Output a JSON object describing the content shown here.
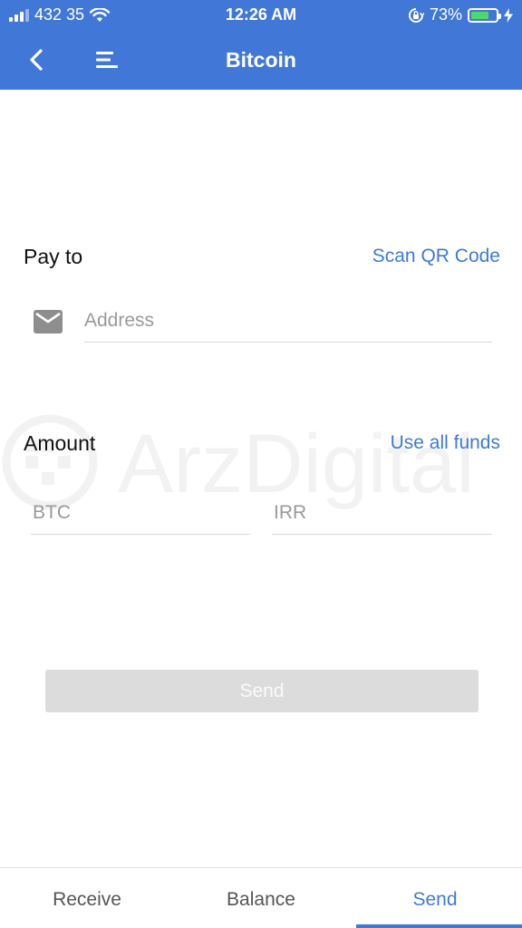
{
  "status_bar": {
    "carrier": "432 35",
    "time": "12:26 AM",
    "battery_percent": "73%",
    "battery_level": 0.73
  },
  "nav": {
    "title": "Bitcoin",
    "back_icon": "chevron-left-icon",
    "menu_icon": "menu-icon"
  },
  "pay_to": {
    "label": "Pay to",
    "scan_link": "Scan QR Code",
    "address_placeholder": "Address"
  },
  "amount": {
    "label": "Amount",
    "use_all_link": "Use all funds",
    "btc_placeholder": "BTC",
    "irr_placeholder": "IRR"
  },
  "send_button": {
    "label": "Send",
    "enabled": false
  },
  "watermark": {
    "text": "ArzDigital"
  },
  "tabs": [
    {
      "label": "Receive",
      "active": false
    },
    {
      "label": "Balance",
      "active": false
    },
    {
      "label": "Send",
      "active": true
    }
  ],
  "colors": {
    "header": "#4178d8",
    "accent": "#3f7ad6",
    "battery": "#4cd964",
    "disabled_button": "#dcdcdc"
  }
}
